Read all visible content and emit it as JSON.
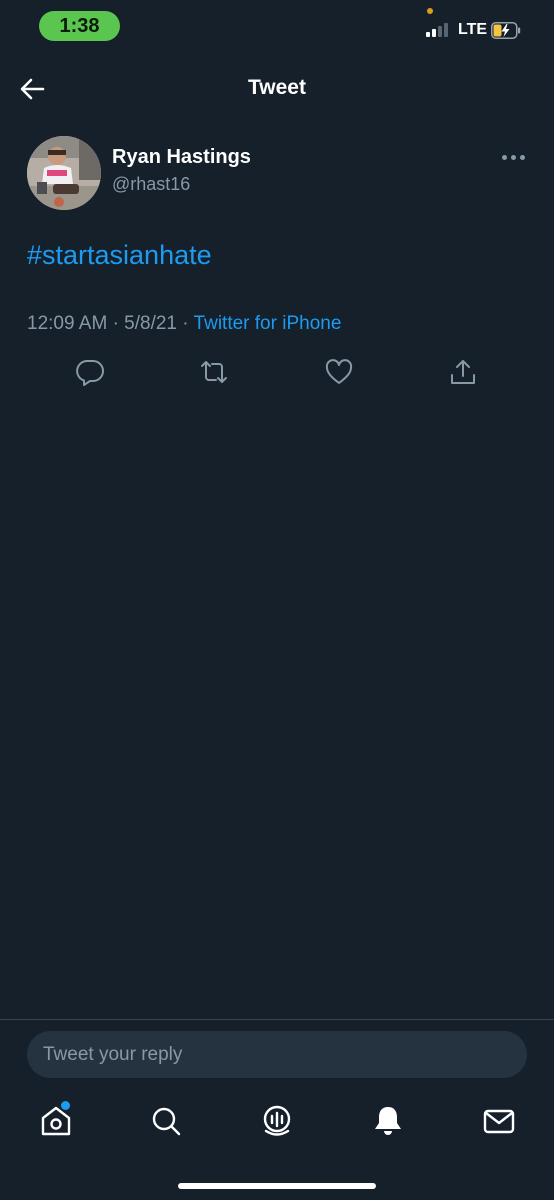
{
  "status_bar": {
    "time": "1:38",
    "network": "LTE"
  },
  "header": {
    "title": "Tweet"
  },
  "tweet": {
    "author_name": "Ryan Hastings",
    "author_handle": "@rhast16",
    "text": "#startasianhate",
    "time": "12:09 AM",
    "date": "5/8/21",
    "separator": "·",
    "source": "Twitter for iPhone"
  },
  "actions": [
    "reply-icon",
    "retweet-icon",
    "like-icon",
    "share-icon"
  ],
  "reply": {
    "placeholder": "Tweet your reply"
  },
  "tab_bar": [
    "home-icon",
    "search-icon",
    "spaces-icon",
    "notifications-icon",
    "messages-icon"
  ],
  "colors": {
    "background": "#15202b",
    "accent": "#1d9bf0",
    "secondary_text": "#8899a6",
    "status_pill": "#5ac54f"
  }
}
